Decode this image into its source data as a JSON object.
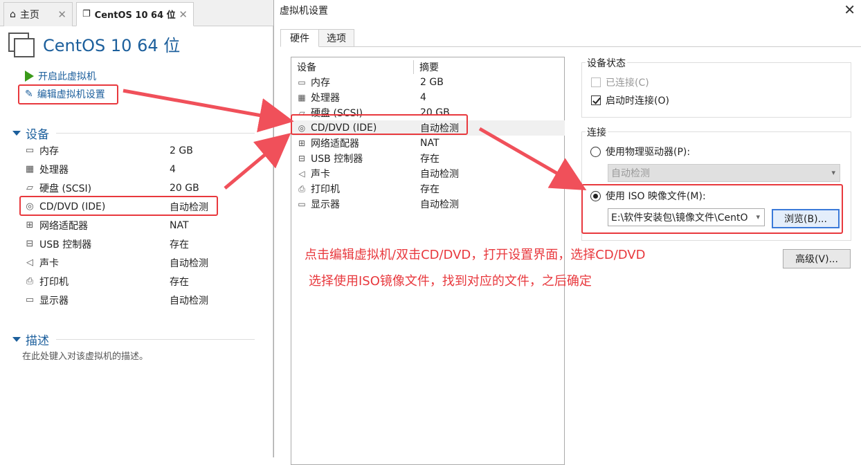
{
  "left": {
    "tabs": [
      {
        "label": "主页"
      },
      {
        "label": "CentOS 10 64 位"
      }
    ],
    "vm_name": "CentOS 10 64 位",
    "actions": {
      "start": "开启此虚拟机",
      "edit": "编辑虚拟机设置"
    },
    "devices_header": "设备",
    "devices": [
      {
        "name": "内存",
        "value": "2 GB",
        "icon": "memory-icon"
      },
      {
        "name": "处理器",
        "value": "4",
        "icon": "processor-icon"
      },
      {
        "name": "硬盘 (SCSI)",
        "value": "20 GB",
        "icon": "harddisk-icon"
      },
      {
        "name": "CD/DVD (IDE)",
        "value": "自动检测",
        "icon": "cdrom-icon"
      },
      {
        "name": "网络适配器",
        "value": "NAT",
        "icon": "network-icon"
      },
      {
        "name": "USB 控制器",
        "value": "存在",
        "icon": "usb-icon"
      },
      {
        "name": "声卡",
        "value": "自动检测",
        "icon": "sound-icon"
      },
      {
        "name": "打印机",
        "value": "存在",
        "icon": "printer-icon"
      },
      {
        "name": "显示器",
        "value": "自动检测",
        "icon": "display-icon"
      }
    ],
    "description_header": "描述",
    "description_placeholder": "在此处键入对该虚拟机的描述。"
  },
  "dialog": {
    "title": "虚拟机设置",
    "tabs": [
      {
        "label": "硬件"
      },
      {
        "label": "选项"
      }
    ],
    "columns": {
      "device": "设备",
      "summary": "摘要"
    },
    "devices": [
      {
        "name": "内存",
        "value": "2 GB"
      },
      {
        "name": "处理器",
        "value": "4"
      },
      {
        "name": "硬盘 (SCSI)",
        "value": "20 GB"
      },
      {
        "name": "CD/DVD (IDE)",
        "value": "自动检测"
      },
      {
        "name": "网络适配器",
        "value": "NAT"
      },
      {
        "name": "USB 控制器",
        "value": "存在"
      },
      {
        "name": "声卡",
        "value": "自动检测"
      },
      {
        "name": "打印机",
        "value": "存在"
      },
      {
        "name": "显示器",
        "value": "自动检测"
      }
    ],
    "selected_device": "CD/DVD (IDE)",
    "device_status": {
      "label": "设备状态",
      "connected": {
        "label": "已连接(C)",
        "checked": false,
        "enabled": false
      },
      "connect_at_power_on": {
        "label": "启动时连接(O)",
        "checked": true,
        "enabled": true
      }
    },
    "connection": {
      "label": "连接",
      "physical_drive": {
        "label": "使用物理驱动器(P):",
        "selected": false,
        "dropdown_value": "自动检测"
      },
      "iso_image": {
        "label": "使用 ISO 映像文件(M):",
        "selected": true,
        "path_value": "E:\\软件安装包\\镜像文件\\CentO"
      },
      "browse_button": "浏览(B)..."
    },
    "advanced_button": "高级(V)..."
  },
  "annotation": {
    "line1": "点击编辑虚拟机/双击CD/DVD，打开设置界面，选择CD/DVD",
    "line2": "选择使用ISO镜像文件，找到对应的文件，之后确定",
    "color": "#e8383d"
  }
}
